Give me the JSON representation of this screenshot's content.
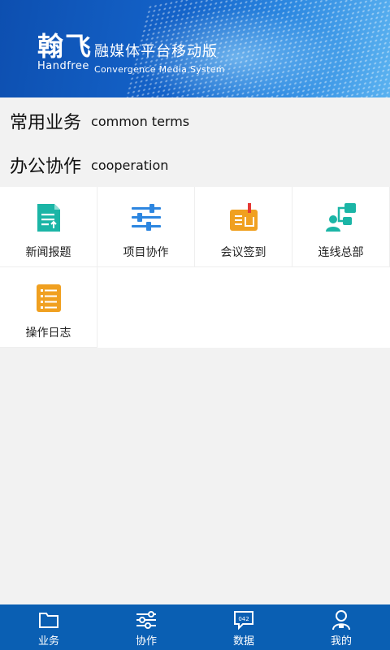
{
  "banner": {
    "brand_cn": "翰飞",
    "brand_en": "Handfree",
    "subtitle_cn": "融媒体平台移动版",
    "subtitle_en": "Convergence Media System"
  },
  "sections": [
    {
      "title_cn": "常用业务",
      "title_en": "common terms"
    },
    {
      "title_cn": "办公协作",
      "title_en": "cooperation"
    }
  ],
  "tiles": [
    {
      "label": "新闻报题",
      "icon": "document-upload-icon",
      "color": "#1bb5a6"
    },
    {
      "label": "项目协作",
      "icon": "sliders-icon",
      "color": "#2d86e0"
    },
    {
      "label": "会议签到",
      "icon": "checkin-icon",
      "color": "#f0a020"
    },
    {
      "label": "连线总部",
      "icon": "connect-icon",
      "color": "#1bb5a6"
    },
    {
      "label": "操作日志",
      "icon": "log-list-icon",
      "color": "#f0a020"
    }
  ],
  "tabbar": {
    "color": "#0a5fb3",
    "items": [
      {
        "label": "业务",
        "icon": "folder-icon"
      },
      {
        "label": "协作",
        "icon": "sliders-icon"
      },
      {
        "label": "数据",
        "icon": "chat-data-icon",
        "badge": "042"
      },
      {
        "label": "我的",
        "icon": "user-icon"
      }
    ]
  }
}
